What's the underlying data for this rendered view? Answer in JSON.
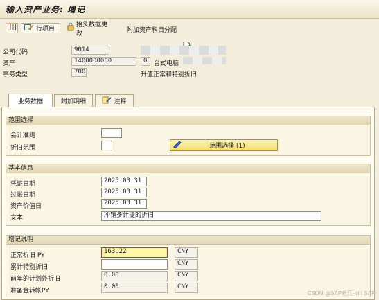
{
  "window": {
    "title": "输入资产业务: 增记"
  },
  "toolbar": {
    "line_items_label": "行项目",
    "header_change_label": "抬头数据更改",
    "additional_account_label": "附加资产科目分配"
  },
  "header": {
    "company_code_label": "公司代码",
    "company_code_value": "9014",
    "asset_label": "资产",
    "asset_value": "1400000000",
    "asset_sub": "0",
    "asset_desc": "台式电脑",
    "trans_type_label": "事务类型",
    "trans_type_value": "700",
    "trans_type_desc": "升值正常和特别折旧"
  },
  "tabs": [
    {
      "label": "业务数据"
    },
    {
      "label": "附加明细"
    },
    {
      "label": "注释"
    }
  ],
  "groups": {
    "range": {
      "title": "范围选择",
      "accounting_principle_label": "会计准则",
      "accounting_principle_value": "",
      "depr_area_label": "折旧范围",
      "depr_area_value": "",
      "range_button_label": "范围选择 (1)"
    },
    "basic": {
      "title": "基本信息",
      "doc_date_label": "凭证日期",
      "doc_date_value": "2025.03.31",
      "posting_date_label": "过帐日期",
      "posting_date_value": "2025.03.31",
      "value_date_label": "资产价值日",
      "value_date_value": "2025.03.31",
      "text_label": "文本",
      "text_value": "冲销多计提的折旧"
    },
    "writeup": {
      "title": "增记说明",
      "rows": [
        {
          "label": "正常折旧 PY",
          "value": "163.22",
          "currency": "CNY"
        },
        {
          "label": "累计特别折旧",
          "value": "",
          "currency": "CNY"
        },
        {
          "label": "前年的计划外折旧",
          "value": "0.00",
          "currency": "CNY"
        },
        {
          "label": "准备金转帐PY",
          "value": "0.00",
          "currency": "CNY"
        }
      ]
    }
  },
  "watermark": "CSDN @SAP老兵-kill SAP"
}
